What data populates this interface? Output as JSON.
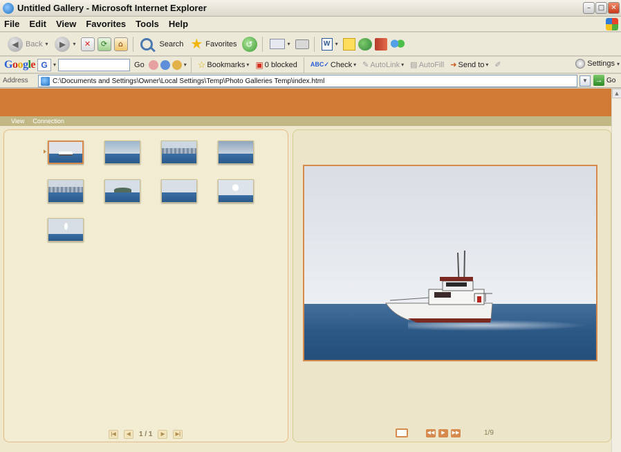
{
  "window": {
    "title": "Untitled Gallery - Microsoft Internet Explorer"
  },
  "menu": [
    "File",
    "Edit",
    "View",
    "Favorites",
    "Tools",
    "Help"
  ],
  "toolbar": {
    "back_label": "Back",
    "search_label": "Search",
    "favorites_label": "Favorites"
  },
  "google_bar": {
    "go_label": "Go",
    "bookmarks_label": "Bookmarks",
    "blocked_label": "0 blocked",
    "check_label": "Check",
    "autolink_label": "AutoLink",
    "autofill_label": "AutoFill",
    "sendto_label": "Send to",
    "settings_label": "Settings"
  },
  "address_bar": {
    "label": "Address",
    "url": "C:\\Documents and Settings\\Owner\\Local Settings\\Temp\\Photo Galleries Temp\\index.html",
    "go_label": "Go"
  },
  "gallery": {
    "nav": [
      "View",
      "Connection"
    ],
    "pager_text": "1 / 1",
    "counter_text": "1/9",
    "selected_index": 1,
    "thumbnails": [
      {
        "name": "thumb-boat"
      },
      {
        "name": "thumb-sea-island"
      },
      {
        "name": "thumb-harbor"
      },
      {
        "name": "thumb-open-sea"
      },
      {
        "name": "thumb-city-skyline"
      },
      {
        "name": "thumb-island"
      },
      {
        "name": "thumb-sea-wave"
      },
      {
        "name": "thumb-splash"
      },
      {
        "name": "thumb-spray"
      }
    ]
  },
  "colors": {
    "banner": "#d07a35",
    "nav_strip": "#c1b886",
    "panel_bg": "#f2ecd2",
    "accent_border": "#d68a4d"
  }
}
